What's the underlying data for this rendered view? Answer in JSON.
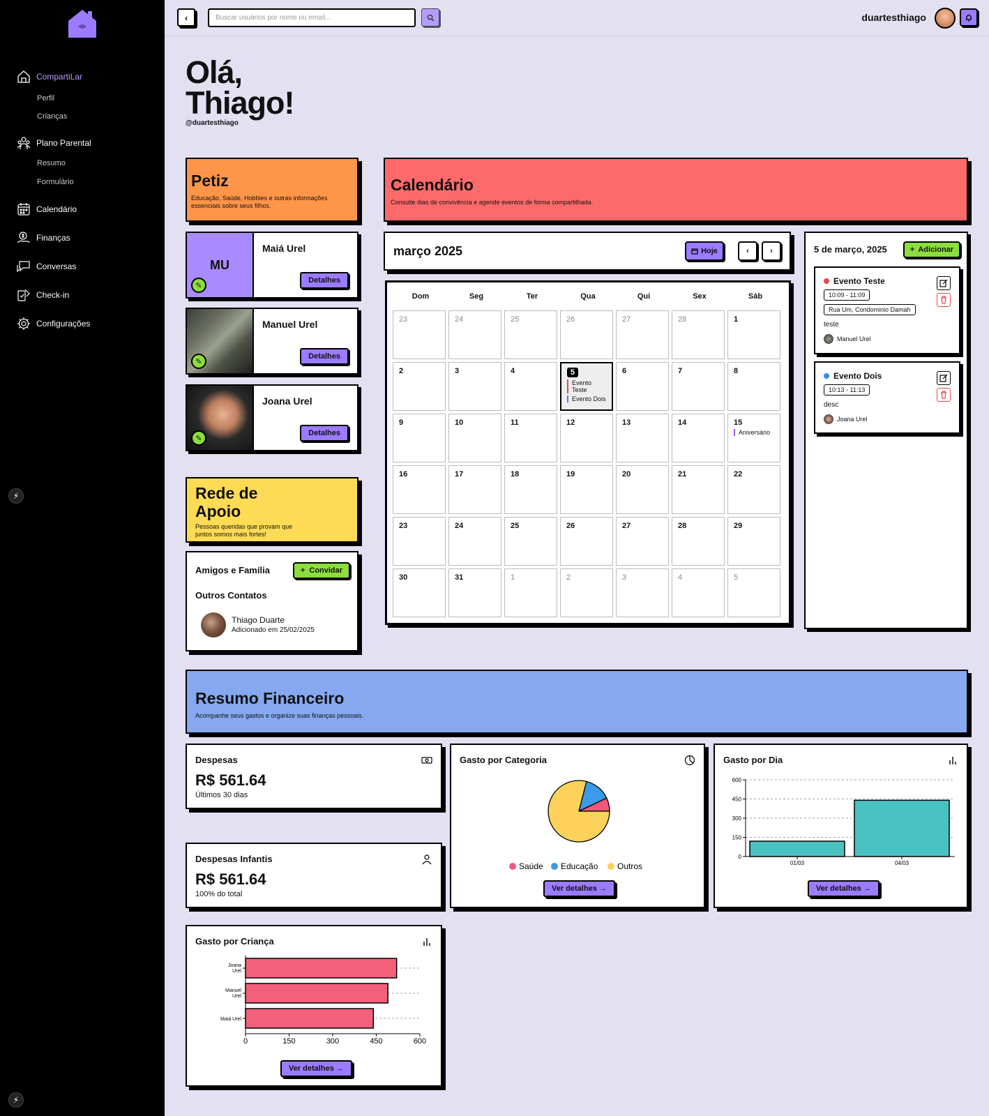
{
  "app": {
    "name": "CompartiLar"
  },
  "sidebar": {
    "items": [
      {
        "label": "CompartiLar",
        "icon": "home-icon"
      },
      {
        "label": "Plano Parental",
        "icon": "family-icon"
      },
      {
        "label": "Calendário",
        "icon": "calendar-icon"
      },
      {
        "label": "Finanças",
        "icon": "money-icon"
      },
      {
        "label": "Conversas",
        "icon": "chat-icon"
      },
      {
        "label": "Check-in",
        "icon": "checkin-icon"
      },
      {
        "label": "Configurações",
        "icon": "gear-icon"
      }
    ],
    "subitems": {
      "perfil": "Perfil",
      "criancas": "Crianças",
      "resumo": "Resumo",
      "formulario": "Formulário"
    }
  },
  "topbar": {
    "search_placeholder": "Buscar usuários por nome ou email...",
    "username": "duartesthiago"
  },
  "greeting": {
    "line1": "Olá,",
    "line2": "Thiago!",
    "handle": "@duartesthiago"
  },
  "petiz": {
    "title": "Petiz",
    "subtitle": "Educação, Saúde, Hobbies e outras informações essenciais sobre seus filhos.",
    "children": [
      {
        "name": "Maiá Urel",
        "initials": "MU",
        "button": "Detalhes"
      },
      {
        "name": "Manuel Urel",
        "initials": "",
        "button": "Detalhes"
      },
      {
        "name": "Joana Urel",
        "initials": "",
        "button": "Detalhes"
      }
    ]
  },
  "rede": {
    "title_line1": "Rede de",
    "title_line2": "Apoio",
    "subtitle_line1": "Pessoas queridas que provam que",
    "subtitle_line2": "juntos somos mais fortes!",
    "friends_title": "Amigos e Família",
    "invite_button": "Convidar",
    "others_title": "Outros Contatos",
    "contact": {
      "name": "Thiago Duarte",
      "added": "Adicionado em 25/02/2025"
    }
  },
  "calendar": {
    "title": "Calendário",
    "subtitle": "Consulte dias de convivência e agende eventos de forma compartilhada.",
    "month": "março 2025",
    "today_button": "Hoje",
    "weekdays": [
      "Dom",
      "Seg",
      "Ter",
      "Qua",
      "Qui",
      "Sex",
      "Sáb"
    ],
    "days": [
      {
        "n": "23",
        "o": true
      },
      {
        "n": "24",
        "o": true
      },
      {
        "n": "25",
        "o": true
      },
      {
        "n": "26",
        "o": true
      },
      {
        "n": "27",
        "o": true
      },
      {
        "n": "28",
        "o": true
      },
      {
        "n": "1"
      },
      {
        "n": "2"
      },
      {
        "n": "3"
      },
      {
        "n": "4"
      },
      {
        "n": "5",
        "today": true,
        "events": [
          {
            "label": "Evento Teste",
            "color": "#e5484d"
          },
          {
            "label": "Evento Dois",
            "color": "#3b82f6"
          }
        ]
      },
      {
        "n": "6"
      },
      {
        "n": "7"
      },
      {
        "n": "8"
      },
      {
        "n": "9"
      },
      {
        "n": "10"
      },
      {
        "n": "11"
      },
      {
        "n": "12"
      },
      {
        "n": "13"
      },
      {
        "n": "14"
      },
      {
        "n": "15",
        "events": [
          {
            "label": "Aniversário",
            "color": "#a855f7"
          }
        ]
      },
      {
        "n": "16"
      },
      {
        "n": "17"
      },
      {
        "n": "18"
      },
      {
        "n": "19"
      },
      {
        "n": "20"
      },
      {
        "n": "21"
      },
      {
        "n": "22"
      },
      {
        "n": "23"
      },
      {
        "n": "24"
      },
      {
        "n": "25"
      },
      {
        "n": "26"
      },
      {
        "n": "27"
      },
      {
        "n": "28"
      },
      {
        "n": "29"
      },
      {
        "n": "30"
      },
      {
        "n": "31"
      },
      {
        "n": "1",
        "o": true
      },
      {
        "n": "2",
        "o": true
      },
      {
        "n": "3",
        "o": true
      },
      {
        "n": "4",
        "o": true
      },
      {
        "n": "5",
        "o": true
      }
    ]
  },
  "day_panel": {
    "date": "5 de março, 2025",
    "add_button": "Adicionar",
    "events": [
      {
        "title": "Evento Teste",
        "color": "#e5484d",
        "time": "10:09 - 11:09",
        "place": "Rua Um, Condominio Damah",
        "desc": "teste",
        "by": "Manuel Urel"
      },
      {
        "title": "Evento Dois",
        "color": "#3b82f6",
        "time": "10:13 - 11:13",
        "place": "",
        "desc": "desc",
        "by": "Joana Urel"
      }
    ]
  },
  "finance": {
    "title": "Resumo Financeiro",
    "subtitle": "Acompanhe seus gastos e organize suas finanças pessoais.",
    "despesas": {
      "title": "Despesas",
      "value": "R$ 561.64",
      "sub": "Últimos 30 dias"
    },
    "infantis": {
      "title": "Despesas Infantis",
      "value": "R$ 561.64",
      "sub": "100% do total"
    },
    "categoria_title": "Gasto por Categoria",
    "dia_title": "Gasto por Dia",
    "crianca_title": "Gasto por Criança",
    "details_button": "Ver detalhes"
  },
  "chart_data": [
    {
      "type": "pie",
      "title": "Gasto por Categoria",
      "categories": [
        "Saúde",
        "Educação",
        "Outros"
      ],
      "values": [
        7,
        14,
        79
      ],
      "colors": [
        "#f2577a",
        "#3b9be8",
        "#fcd15a"
      ],
      "legend": "bottom"
    },
    {
      "type": "bar",
      "title": "Gasto por Dia",
      "categories": [
        "01/03",
        "04/03"
      ],
      "values": [
        120,
        440
      ],
      "ylim": [
        0,
        600
      ],
      "yticks": [
        0,
        150,
        300,
        450,
        600
      ],
      "grid": true,
      "color": "#4bc2c2"
    },
    {
      "type": "bar",
      "orientation": "horizontal",
      "title": "Gasto por Criança",
      "categories": [
        "Joana Urel",
        "Manuel Urel",
        "Maiá Urel"
      ],
      "values": [
        520,
        490,
        440
      ],
      "xlim": [
        0,
        600
      ],
      "xticks": [
        0,
        150,
        300,
        450,
        600
      ],
      "grid": true,
      "color": "#f2607b"
    }
  ]
}
